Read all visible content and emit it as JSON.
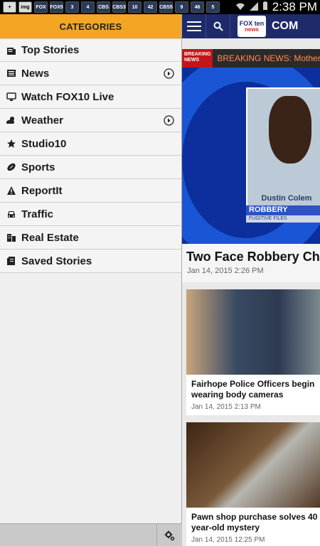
{
  "status_bar": {
    "notification_icons": [
      "+",
      "img",
      "FOX",
      "FOX5",
      "3",
      "4",
      "CBS",
      "CBS3",
      "10",
      "42",
      "CBS5",
      "9",
      "46",
      "5"
    ],
    "time": "2:38 PM",
    "icons": [
      "wifi-icon",
      "signal-icon",
      "battery-icon"
    ]
  },
  "drawer": {
    "header": "CATEGORIES",
    "items": [
      {
        "label": "Top Stories",
        "icon": "newspaper-icon",
        "expandable": false
      },
      {
        "label": "News",
        "icon": "news-icon",
        "expandable": true
      },
      {
        "label": "Watch FOX10 Live",
        "icon": "tv-icon",
        "expandable": false
      },
      {
        "label": "Weather",
        "icon": "weather-icon",
        "expandable": true
      },
      {
        "label": "Studio10",
        "icon": "star-icon",
        "expandable": false
      },
      {
        "label": "Sports",
        "icon": "football-icon",
        "expandable": false
      },
      {
        "label": "ReportIt",
        "icon": "warning-icon",
        "expandable": false
      },
      {
        "label": "Traffic",
        "icon": "car-icon",
        "expandable": false
      },
      {
        "label": "Real Estate",
        "icon": "building-icon",
        "expandable": false
      },
      {
        "label": "Saved Stories",
        "icon": "saved-icon",
        "expandable": false
      }
    ],
    "settings_icon": "gear-icon"
  },
  "main": {
    "appbar": {
      "logo_line1": "FOX ten",
      "logo_line2": "news",
      "trailing_text": "COM"
    },
    "breaking": {
      "tag": "BREAKING NEWS",
      "text": "BREAKING NEWS: Mother"
    },
    "hero": {
      "name": "Dustin Colem",
      "banner": "ROBBERY",
      "sub": "FUGITIVE FILES"
    },
    "top_story": {
      "title": "Two Face Robbery Ch",
      "date": "Jan 14, 2015 2:26 PM"
    },
    "cards": [
      {
        "title_line1": "Fairhope Police Officers begin",
        "title_line2": "wearing body cameras",
        "date": "Jan 14, 2015 2:13 PM"
      },
      {
        "title_line1": "Pawn shop purchase solves 40",
        "title_line2": "year-old mystery",
        "date": "Jan 14, 2015 12:25 PM"
      }
    ]
  },
  "colors": {
    "drawer_header": "#f3a623",
    "appbar": "#1f2a6b",
    "breaking_red": "#c2161b"
  }
}
